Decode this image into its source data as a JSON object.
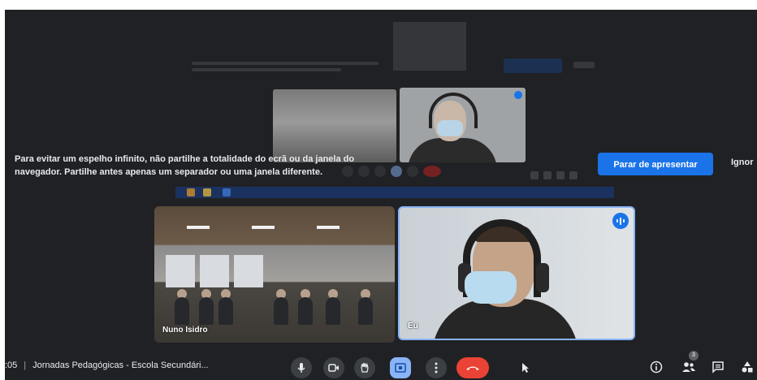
{
  "banner": {
    "message_line1": "Para evitar um espelho infinito, não partilhe a totalidade do ecrã ou da janela do",
    "message_line2": "navegador. Partilhe antes apenas um separador ou uma janela diferente.",
    "stop_label": "Parar de apresentar",
    "ignore_label": "Ignor"
  },
  "tiles": {
    "room_name": "Nuno Isidro",
    "self_name": "Eu"
  },
  "toolbar": {
    "time": ":05",
    "meeting_title": "Jornadas Pedagógicas - Escola Secundári...",
    "participant_count": "3"
  },
  "colors": {
    "background": "#202124",
    "accent": "#1a73e8",
    "hangup": "#ea4335"
  },
  "icons": [
    "mic-icon",
    "camera-icon",
    "raise-hand-icon",
    "present-icon",
    "more-icon",
    "hangup-icon",
    "cursor-icon",
    "info-icon",
    "people-icon",
    "chat-icon",
    "activities-icon"
  ]
}
